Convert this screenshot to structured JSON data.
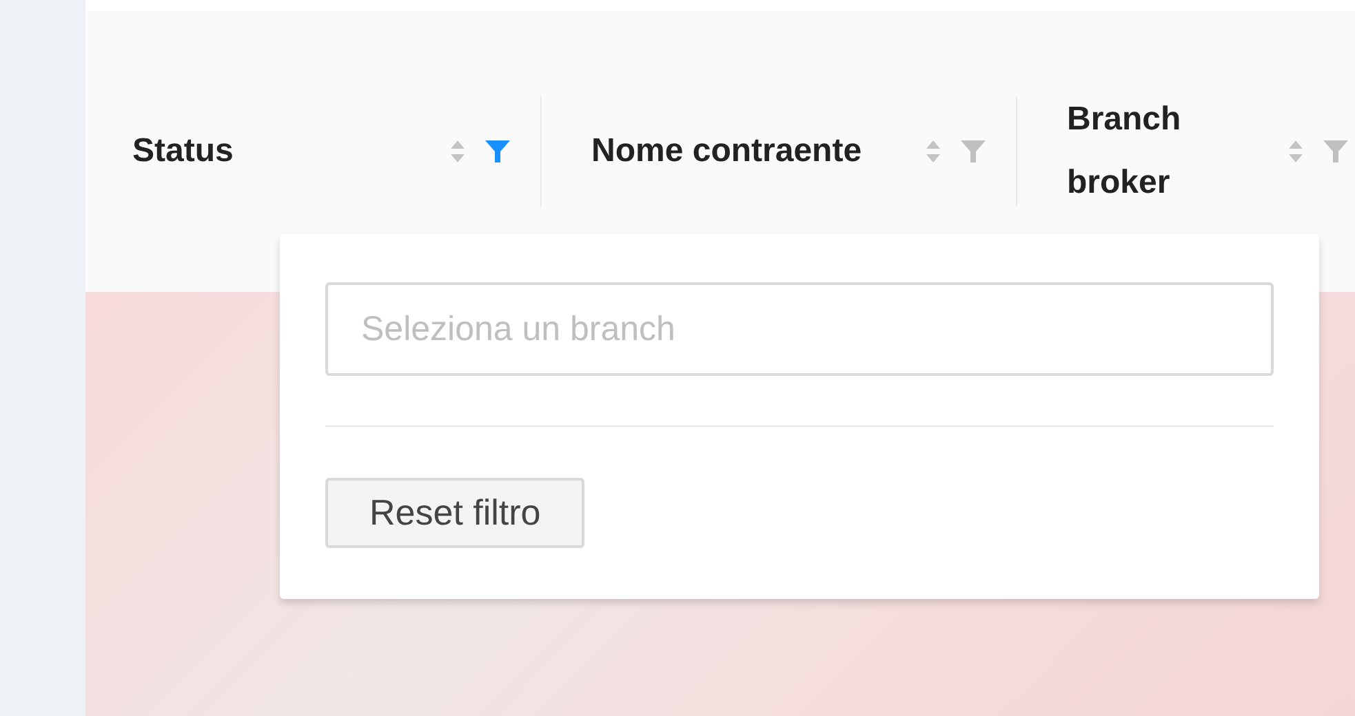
{
  "table": {
    "columns": [
      {
        "label": "Status",
        "filter_active": true
      },
      {
        "label": "Nome contraente",
        "filter_active": false
      },
      {
        "label": "Branch broker",
        "filter_active": false
      }
    ]
  },
  "filter_dropdown": {
    "search": {
      "placeholder": "Seleziona un branch"
    },
    "reset_button": "Reset filtro"
  }
}
